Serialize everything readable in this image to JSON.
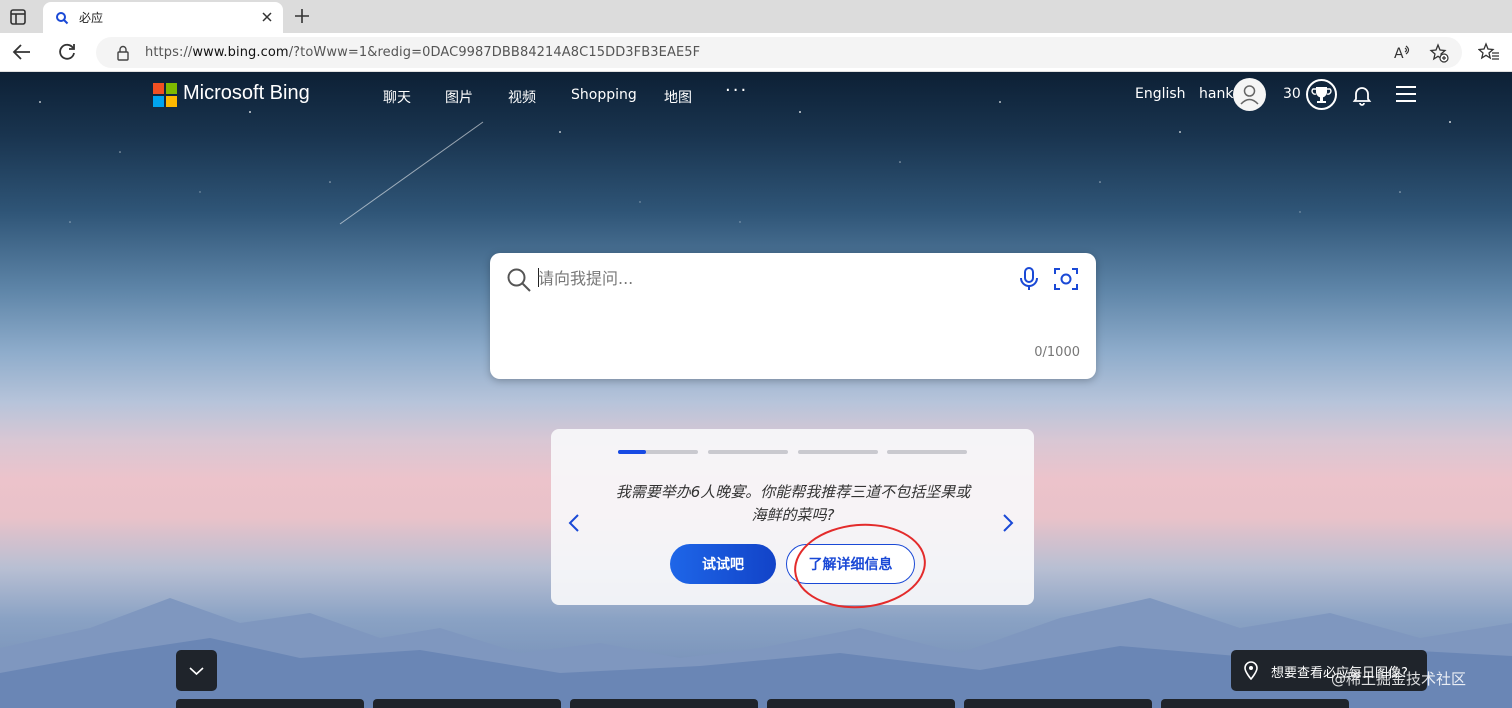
{
  "browser": {
    "tab_title": "必应",
    "url_prefix": "https://",
    "url_host": "www.bing.com",
    "url_rest": "/?toWww=1&redig=0DAC9987DBB84214A8C15DD3FB3EAE5F"
  },
  "header": {
    "logo_text": "Microsoft Bing",
    "nav": [
      "聊天",
      "图片",
      "视频",
      "Shopping",
      "地图"
    ],
    "more": "···",
    "language": "English",
    "username": "hank",
    "points": "30"
  },
  "search": {
    "placeholder": "请向我提问...",
    "counter": "0/1000"
  },
  "prompt_card": {
    "active_index": 0,
    "progress_fraction": 0.35,
    "text": "我需要举办6人晚宴。你能帮我推荐三道不包括坚果或海鲜的菜吗?",
    "try_label": "试试吧",
    "learn_label": "了解详细信息"
  },
  "footer": {
    "image_question": "想要查看必应每日图像?",
    "watermark": "@稀土掘金技术社区"
  },
  "colors": {
    "accent": "#174ae4",
    "annotation": "#e32b2b"
  }
}
